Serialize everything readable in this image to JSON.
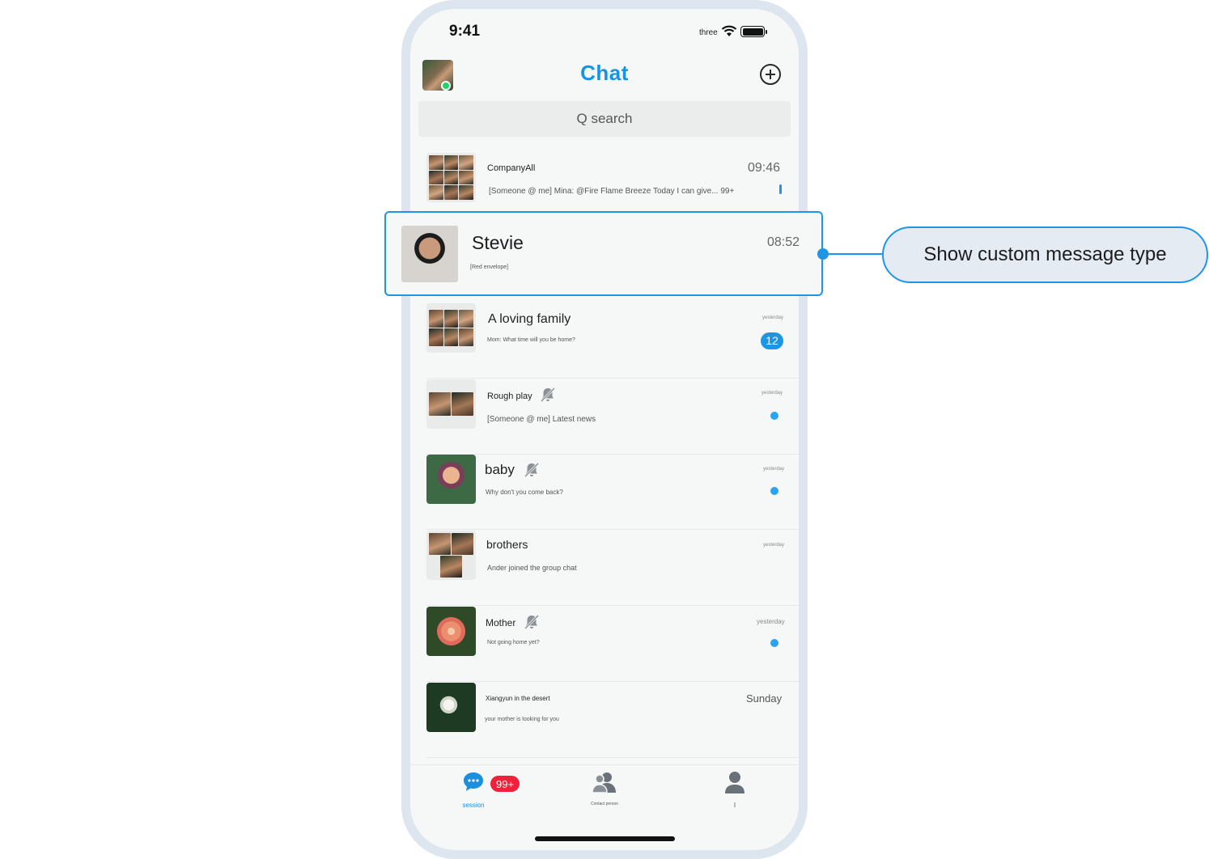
{
  "status_bar": {
    "time": "9:41",
    "carrier": "three"
  },
  "header": {
    "title": "Chat",
    "add_icon": "plus-circle-icon",
    "avatar_status": "online"
  },
  "search": {
    "placeholder": "Q search"
  },
  "conversations": [
    {
      "name": "CompanyAll",
      "message": "[Someone @ me] Mina: @Fire Flame Breeze Today I can give... 99+",
      "time": "09:46"
    },
    {
      "name": "Stevie",
      "message": "[Red envelope]",
      "time": "08:52"
    },
    {
      "name": "A loving family",
      "message": "Mom: What time will you be home?",
      "time": "yesterday",
      "unread": "12"
    },
    {
      "name": "Rough play",
      "message": "[Someone @ me] Latest news",
      "time": "yesterday",
      "muted": true
    },
    {
      "name": "baby",
      "message": "Why don't you come back?",
      "time": "yesterday",
      "muted": true
    },
    {
      "name": "brothers",
      "message": "Ander joined the group chat",
      "time": "yesterday"
    },
    {
      "name": "Mother",
      "message": "Not going home yet?",
      "time": "yesterday",
      "muted": true
    },
    {
      "name": "Xiangyun in the desert",
      "message": "your mother is looking for you",
      "time": "Sunday"
    }
  ],
  "callout": {
    "text": "Show custom message type"
  },
  "tabbar": {
    "tabs": [
      {
        "label": "session",
        "badge": "99+"
      },
      {
        "label": "Contact person"
      },
      {
        "label": "I"
      }
    ]
  },
  "colors": {
    "accent": "#1e96e6",
    "badge": "#f0213a",
    "online": "#1fd46b"
  }
}
